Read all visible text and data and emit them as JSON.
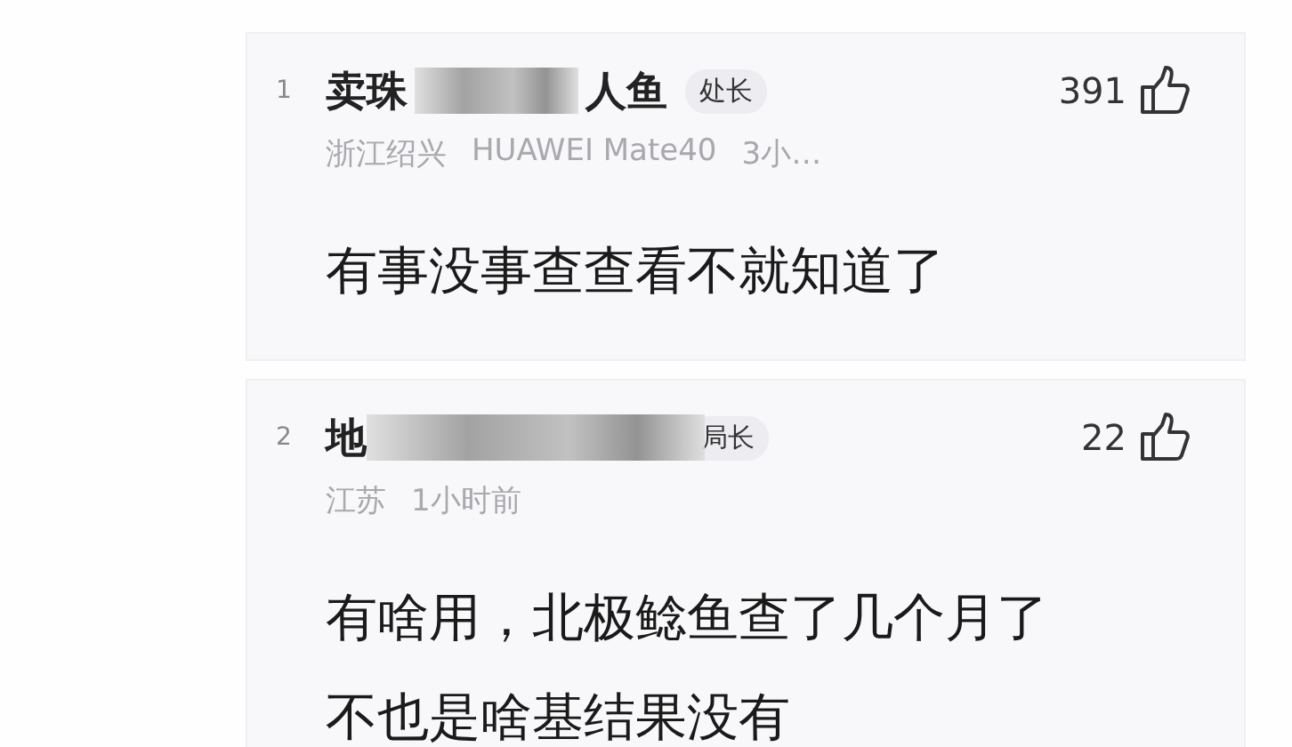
{
  "comments": [
    {
      "rank": "1",
      "name_parts": [
        {
          "kind": "text",
          "text": "卖珠"
        },
        {
          "kind": "redaction"
        },
        {
          "kind": "text",
          "text": "人鱼"
        }
      ],
      "badge": "处长",
      "likes": "391",
      "meta": [
        "浙江绍兴",
        "HUAWEI Mate40",
        "3小…"
      ],
      "text": "有事没事查查看不就知道了"
    },
    {
      "rank": "2",
      "name_parts": [
        {
          "kind": "text",
          "text": "地"
        },
        {
          "kind": "redaction"
        }
      ],
      "badge": "局长",
      "likes": "22",
      "meta": [
        "江苏",
        "1小时前"
      ],
      "text": "有啥用，北极鲶鱼查了几个月了不也是啥基结果没有"
    }
  ]
}
